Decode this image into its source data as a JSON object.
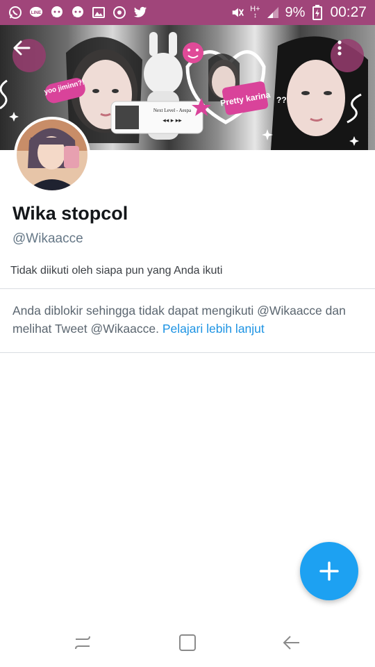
{
  "status_bar": {
    "battery_percent": "9%",
    "time": "00:27",
    "network": "H+",
    "background_color": "#a0457a",
    "left_icons": [
      "whatsapp-icon",
      "line-icon",
      "chat-bubble-icon",
      "chat-bubble-icon",
      "gallery-icon",
      "sync-icon",
      "twitter-icon"
    ],
    "right_icons": [
      "mute-icon",
      "network-data-icon",
      "signal-icon",
      "battery-icon"
    ]
  },
  "header": {
    "banner_texts": {
      "sticker_1": "yoo jiminn?!",
      "player_title": "Next Level - Aespa",
      "sticker_2": "Pretty karina",
      "question": "??"
    }
  },
  "profile": {
    "name": "Wika stopcol",
    "handle": "@Wikaacce",
    "followers_note": "Tidak diikuti oleh siapa pun yang Anda ikuti",
    "blocked_message": "Anda diblokir sehingga tidak dapat mengikuti @Wikaacce dan melihat Tweet @Wikaacce.",
    "learn_more_link": "Pelajari lebih lanjut"
  },
  "colors": {
    "accent": "#1da1f2",
    "link": "#1c93e3"
  }
}
